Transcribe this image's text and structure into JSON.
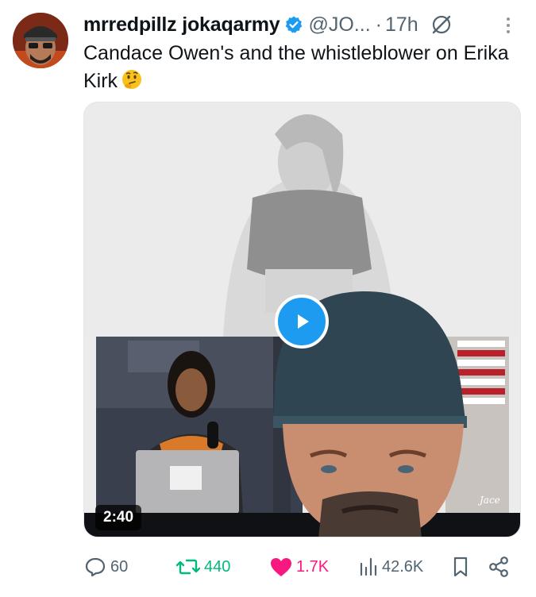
{
  "tweet": {
    "display_name": "mrredpillz jokaqarmy",
    "handle": "@JO...",
    "separator": "·",
    "time": "17h",
    "text": "Candace Owen's and the whistleblower on Erika Kirk",
    "emoji": "thinking-face"
  },
  "media": {
    "duration": "2:40",
    "overlay_text": "Jace"
  },
  "actions": {
    "replies": "60",
    "reposts": "440",
    "likes": "1.7K",
    "views": "42.6K"
  },
  "colors": {
    "verified": "#1d9bf0",
    "repost": "#00ba7c",
    "like": "#f91880",
    "muted": "#536471",
    "play": "#1d9bf0"
  }
}
